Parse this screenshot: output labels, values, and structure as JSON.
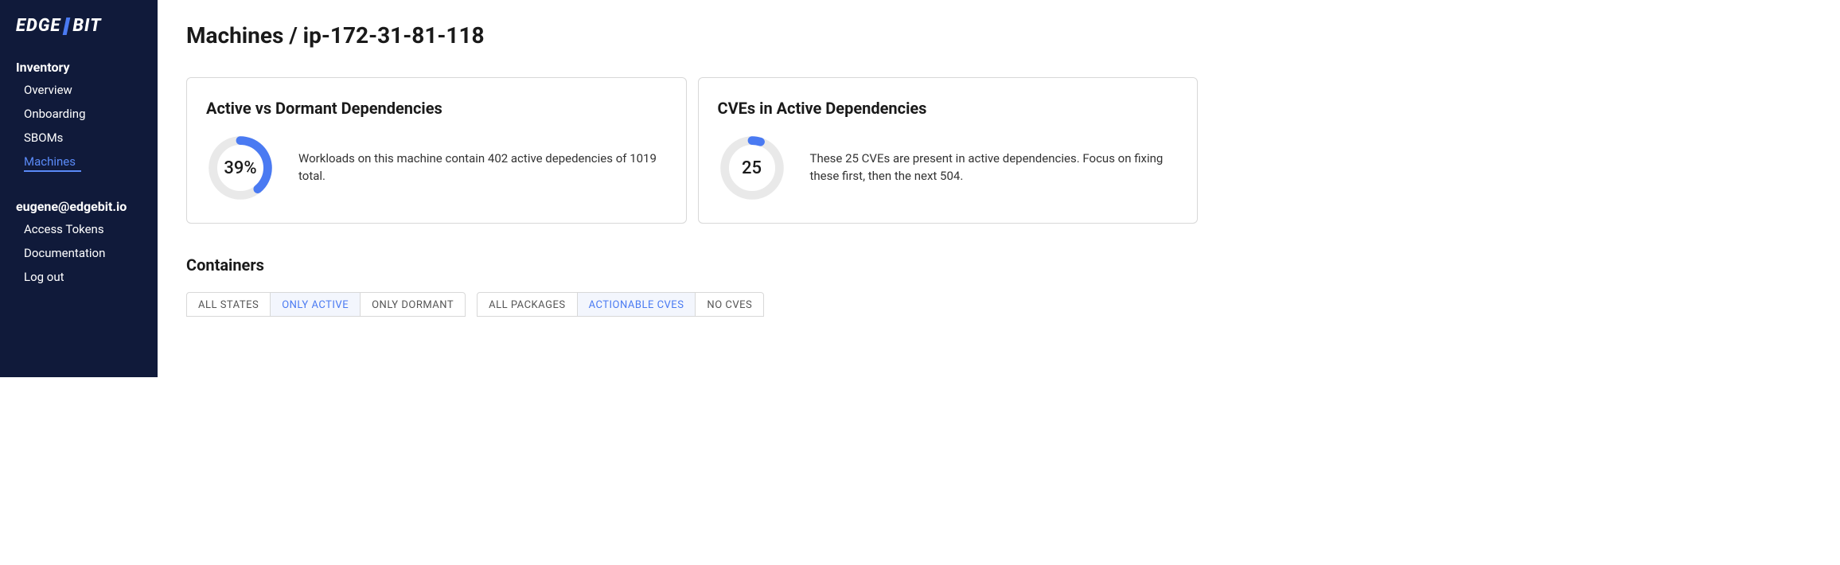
{
  "logo": {
    "left": "EDGE",
    "right": "BIT"
  },
  "nav": {
    "section1_title": "Inventory",
    "items1": [
      {
        "label": "Overview"
      },
      {
        "label": "Onboarding"
      },
      {
        "label": "SBOMs"
      },
      {
        "label": "Machines",
        "active": true
      }
    ],
    "section2_title": "eugene@edgebit.io",
    "items2": [
      {
        "label": "Access Tokens"
      },
      {
        "label": "Documentation"
      },
      {
        "label": "Log out"
      }
    ]
  },
  "breadcrumb": "Machines / ip-172-31-81-118",
  "cards": {
    "deps": {
      "title": "Active vs Dormant Dependencies",
      "percent_label": "39%",
      "percent_frac": 0.39,
      "text": "Workloads on this machine contain 402 active depedencies of 1019 total."
    },
    "cves": {
      "title": "CVEs in Active Dependencies",
      "count_label": "25",
      "percent_frac": 0.05,
      "text": "These 25 CVEs are present in active dependencies. Focus on fixing these first, then the next 504."
    }
  },
  "containers": {
    "title": "Containers",
    "state_filters": [
      {
        "label": "ALL STATES"
      },
      {
        "label": "ONLY ACTIVE",
        "active": true
      },
      {
        "label": "ONLY DORMANT"
      }
    ],
    "package_filters": [
      {
        "label": "ALL PACKAGES"
      },
      {
        "label": "ACTIONABLE CVES",
        "active": true
      },
      {
        "label": "NO CVES"
      }
    ]
  }
}
